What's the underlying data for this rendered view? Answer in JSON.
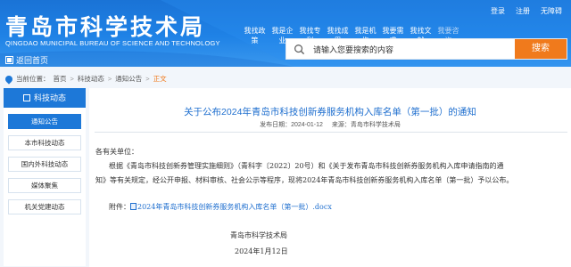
{
  "header": {
    "brand_cn": "青岛市科学技术局",
    "brand_en": "QINGDAO MUNICIPAL BUREAU OF SCIENCE AND TECHNOLOGY",
    "top_links": [
      "登录",
      "注册",
      "无障碍"
    ],
    "nav": [
      "我找政策",
      "我是企业",
      "我找专利",
      "我找成果",
      "我是机构",
      "我要需求",
      "我找文献",
      "我要咨询"
    ],
    "search_placeholder": "请输入您要搜索的内容",
    "search_button": "搜索",
    "home_label": "返回首页"
  },
  "breadcrumb": {
    "label": "当前位置：",
    "items": [
      "首页",
      "科技动态",
      "通知公告",
      "正文"
    ]
  },
  "sidebar": {
    "title": "科技动态",
    "items": [
      "通知公告",
      "本市科技动态",
      "国内外科技动态",
      "媒体聚焦",
      "机关党建动态"
    ],
    "active_index": 0
  },
  "article": {
    "title": "关于公布2024年青岛市科技创新券服务机构入库名单（第一批）的通知",
    "date": "发布日期：2024-01-12",
    "source": "来源：青岛市科学技术局",
    "salutation": "各有关单位：",
    "body_line1": "根据《青岛市科技创新券管理实施细则》（青科字〔2022〕20号）和《关于发布青岛市科技创新券服务机构入库申请指南的通",
    "body_line2": "知》等有关规定，经公开申报、材料审核、社会公示等程序，现将2024年青岛市科技创新券服务机构入库名单（第一批）予以公布。",
    "attachment_label": "附件：",
    "attachment_file": "2024年青岛市科技创新券服务机构入库名单（第一批）.docx",
    "signature": "青岛市科学技术局",
    "sign_date": "2024年1月12日"
  },
  "colors": {
    "header_blue": "#1f82e6",
    "accent_blue": "#1d78d8",
    "search_orange": "#f07a1c",
    "title_blue": "#1f6fcf"
  }
}
